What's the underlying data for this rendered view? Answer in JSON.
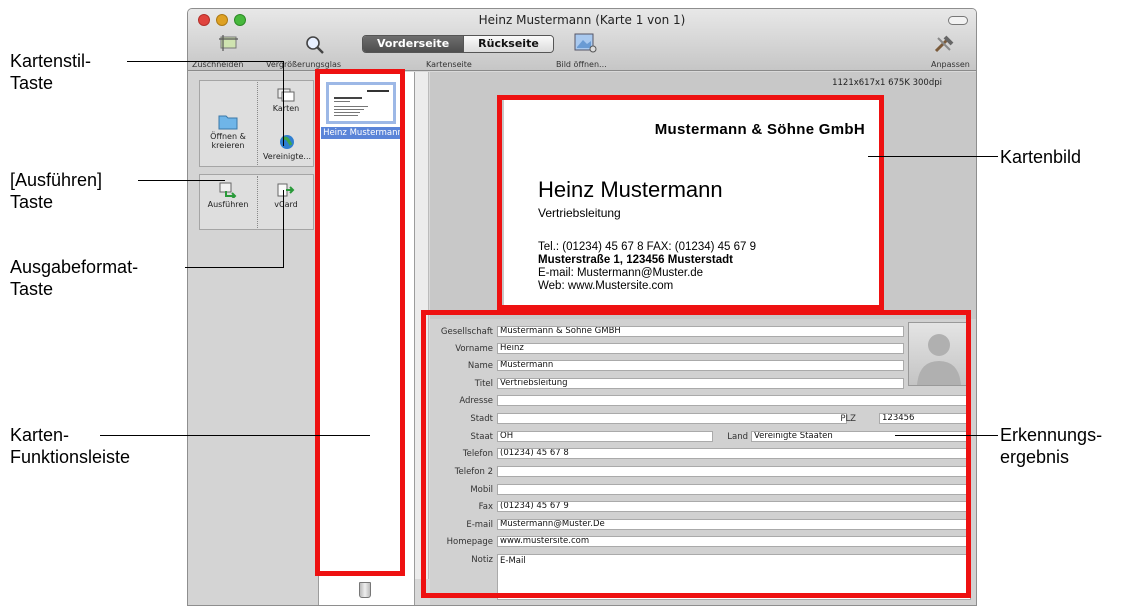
{
  "window": {
    "title": "Heinz Mustermann (Karte 1 von 1)"
  },
  "toolbar": {
    "crop_label": "Zuschneiden",
    "magnifier_label": "Vergrößerungsglas",
    "front_label": "Vorderseite",
    "back_label": "Rückseite",
    "card_side_label": "Kartenseite",
    "open_image_label": "Bild öffnen...",
    "customize_label": "Anpassen"
  },
  "palette": {
    "open_create_label": "Öffnen & kreieren",
    "cards_label": "Karten",
    "united_label": "Vereinigte...",
    "execute_label": "Ausführen",
    "vcard_label": "vCard"
  },
  "card_list": {
    "selected_name": "Heinz Mustermann"
  },
  "image_info": "1121x617x1  675K  300dpi",
  "card_image": {
    "company": "Mustermann & Söhne GmbH",
    "name": "Heinz Mustermann",
    "title": "Vertriebsleitung",
    "line1": "Tel.: (01234) 45 67 8 FAX: (01234) 45 67 9",
    "line2": "Musterstraße 1, 123456 Musterstadt",
    "line3": "E-mail: Mustermann@Muster.de",
    "line4": "Web: www.Mustersite.com"
  },
  "form": {
    "labels": {
      "company": "Gesellschaft",
      "first_name": "Vorname",
      "name": "Name",
      "title": "Titel",
      "address": "Adresse",
      "city": "Stadt",
      "zip": "PLZ",
      "state": "Staat",
      "country": "Land",
      "phone": "Telefon",
      "phone2": "Telefon 2",
      "mobile": "Mobil",
      "fax": "Fax",
      "email": "E-mail",
      "homepage": "Homepage",
      "note": "Notiz"
    },
    "values": {
      "company": "Mustermann & Sohne GMBH",
      "first_name": "Heinz",
      "name": "Mustermann",
      "title": "Vertriebsleitung",
      "address": "",
      "city": "",
      "zip": "123456",
      "state": "OH",
      "country": "Vereinigte Staaten",
      "phone": "(01234) 45 67 8",
      "phone2": "",
      "mobile": "",
      "fax": "(01234) 45 67 9",
      "email": "Mustermann@Muster.De",
      "homepage": "www.mustersite.com",
      "note": "E-Mail"
    }
  },
  "callouts": {
    "card_style_1": "Kartenstil-",
    "card_style_2": "Taste",
    "execute_1": "[Ausführen]",
    "execute_2": "Taste",
    "output_1": "Ausgabeformat-",
    "output_2": "Taste",
    "function_bar_1": "Karten-",
    "function_bar_2": "Funktionsleiste",
    "card_image": "Kartenbild",
    "result_1": "Erkennungs-",
    "result_2": "ergebnis"
  },
  "colors": {
    "highlight": "#ee1111",
    "selection": "#5a84d8"
  }
}
